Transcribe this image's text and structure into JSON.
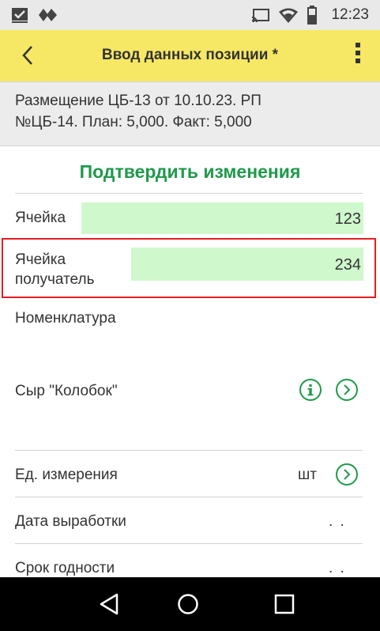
{
  "status_bar": {
    "time": "12:23",
    "icons": [
      "checkbox-icon",
      "diamond-icon",
      "cast-icon",
      "wifi-icon",
      "battery-icon"
    ]
  },
  "app_bar": {
    "title": "Ввод данных позиции *",
    "back_icon": "chevron-left-icon",
    "menu_icon": "more-vert-icon"
  },
  "info": {
    "line1": "Размещение ЦБ-13 от 10.10.23. РП",
    "line2": "№ЦБ-14. План: 5,000. Факт: 5,000"
  },
  "confirm_label": "Подтвердить изменения",
  "fields": {
    "cell_label": "Ячейка",
    "cell_value": "123",
    "recipient_label_line1": "Ячейка",
    "recipient_label_line2": "получатель",
    "recipient_value": "234",
    "nomenclature_label": "Номенклатура",
    "nomenclature_value": "Сыр \"Колобок\"",
    "unit_label": "Ед. измерения",
    "unit_value": "шт",
    "production_date_label": "Дата выработки",
    "production_date_value": ". .",
    "expiry_label": "Срок годности",
    "expiry_value": ". ."
  },
  "colors": {
    "accent_green": "#1f9a4a",
    "app_bar_yellow": "#f6e865",
    "field_green": "#cff8cc",
    "highlight_red": "#e31e24"
  },
  "nav_bar": {
    "icons": [
      "back-triangle-icon",
      "home-circle-icon",
      "recents-square-icon"
    ]
  }
}
